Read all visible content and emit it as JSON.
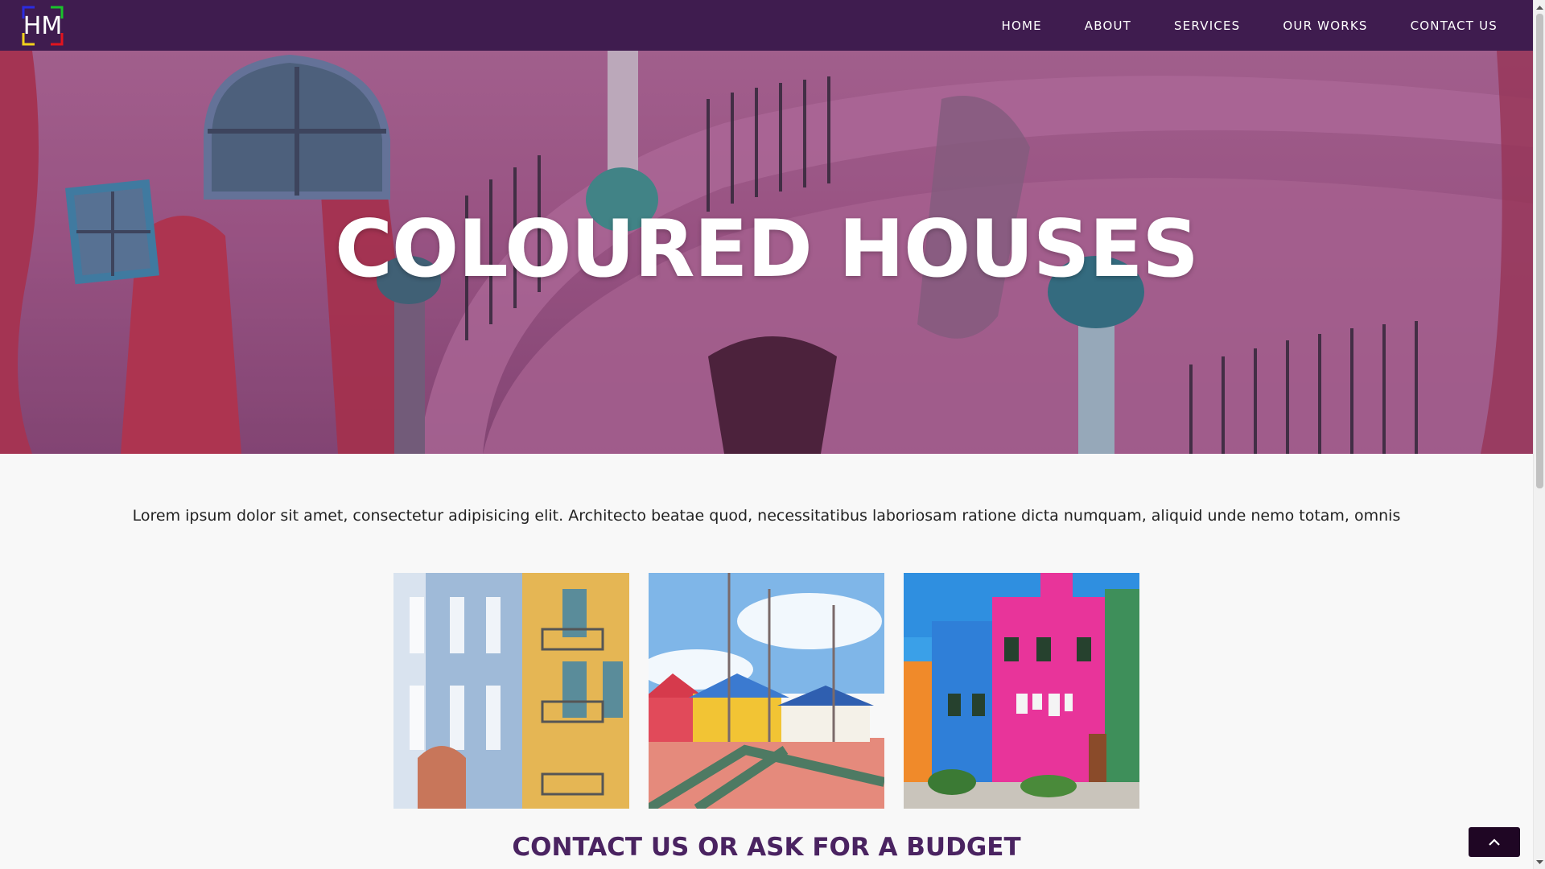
{
  "navbar": {
    "logo_text": "HM",
    "links": [
      "HOME",
      "ABOUT",
      "SERVICES",
      "OUR WORKS",
      "CONTACT US"
    ],
    "background": "#3f1c4f"
  },
  "hero": {
    "title": "COLOURED HOUSES"
  },
  "intro": {
    "text": "Lorem ipsum dolor sit amet, consectetur adipisicing elit. Architecto beatae quod, necessitatibus laboriosam ratione dicta numquam, aliquid unde nemo totam, omnis"
  },
  "gallery": {
    "items": [
      "blue-and-yellow-buildings-photo",
      "colourful-beach-houses-photo",
      "burano-pink-houses-photo"
    ]
  },
  "contact": {
    "heading": "CONTACT US OR ASK FOR A BUDGET",
    "color": "#4a2361"
  },
  "back_to_top": {
    "icon": "chevron-up-icon"
  },
  "colors": {
    "accent": "#3f1c4f",
    "button": "#1f0624"
  }
}
